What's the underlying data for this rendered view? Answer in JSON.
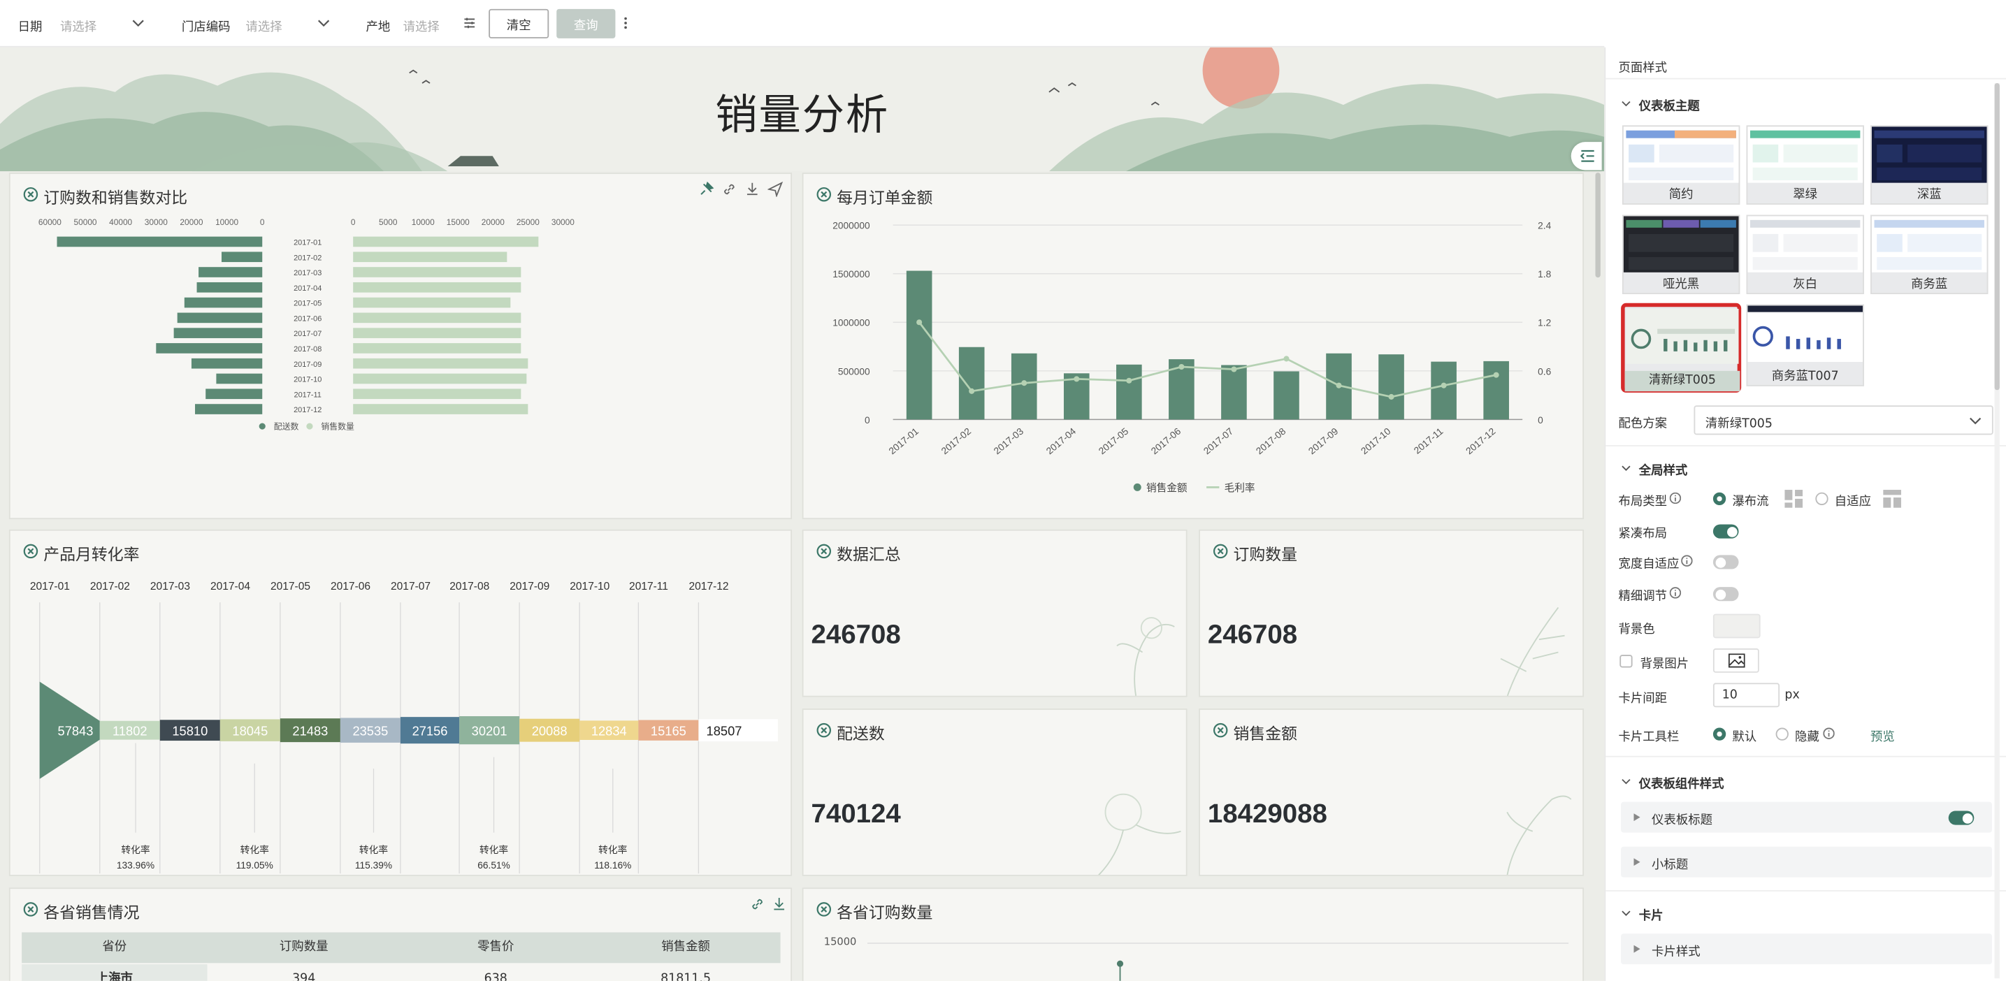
{
  "filters": {
    "date_label": "日期",
    "date_placeholder": "请选择",
    "store_label": "门店编码",
    "store_placeholder": "请选择",
    "origin_label": "产地",
    "origin_placeholder": "请选择",
    "clear_label": "清空",
    "query_label": "查询"
  },
  "dashboard": {
    "title": "销量分析"
  },
  "cards": {
    "purchase_vs_sales": {
      "title": "订购数和销售数对比"
    },
    "monthly_amount": {
      "title": "每月订单金额"
    },
    "conversion": {
      "title": "产品月转化率"
    },
    "summary": {
      "title": "数据汇总",
      "value": "246708"
    },
    "order_qty": {
      "title": "订购数量",
      "value": "246708"
    },
    "delivery": {
      "title": "配送数",
      "value": "740124"
    },
    "sales_amount": {
      "title": "销售金额",
      "value": "18429088"
    },
    "province_sales": {
      "title": "各省销售情况",
      "columns": [
        "省份",
        "订购数量",
        "零售价",
        "销售金额"
      ],
      "rows": [
        [
          "上海市",
          "394",
          "638",
          "81811.5"
        ]
      ]
    },
    "province_orders": {
      "title": "各省订购数量"
    }
  },
  "chart_data": [
    {
      "type": "bar",
      "title": "订购数和销售数对比",
      "categories": [
        "2017-01",
        "2017-02",
        "2017-03",
        "2017-04",
        "2017-05",
        "2017-06",
        "2017-07",
        "2017-08",
        "2017-09",
        "2017-10",
        "2017-11",
        "2017-12"
      ],
      "left_axis_ticks": [
        "60000",
        "50000",
        "40000",
        "30000",
        "20000",
        "10000",
        "0"
      ],
      "right_axis_ticks": [
        "0",
        "5000",
        "10000",
        "15000",
        "20000",
        "25000",
        "30000"
      ],
      "series": [
        {
          "name": "配送数",
          "values": [
            58000,
            11500,
            18000,
            18500,
            22000,
            24000,
            25000,
            30000,
            20000,
            13000,
            16000,
            19000
          ]
        },
        {
          "name": "销售数量",
          "values": [
            26500,
            22000,
            24000,
            24000,
            22500,
            24000,
            24000,
            24000,
            25000,
            24800,
            24000,
            25000
          ]
        }
      ]
    },
    {
      "type": "bar",
      "title": "每月订单金额",
      "categories": [
        "2017-01",
        "2017-02",
        "2017-03",
        "2017-04",
        "2017-05",
        "2017-06",
        "2017-07",
        "2017-08",
        "2017-09",
        "2017-10",
        "2017-11",
        "2017-12"
      ],
      "y_ticks": [
        "0",
        "500000",
        "1000000",
        "1500000",
        "2000000"
      ],
      "y2_ticks": [
        "0",
        "0.6",
        "1.2",
        "1.8",
        "2.4"
      ],
      "ylim": [
        0,
        2000000
      ],
      "y2lim": [
        0,
        2.4
      ],
      "series": [
        {
          "name": "销售金额",
          "type": "bar",
          "values": [
            1530000,
            745000,
            680000,
            475000,
            565000,
            620000,
            560000,
            495000,
            680000,
            670000,
            595000,
            600000
          ]
        },
        {
          "name": "毛利率",
          "type": "line",
          "axis": "right",
          "values": [
            1.2,
            0.35,
            0.45,
            0.5,
            0.48,
            0.65,
            0.62,
            0.75,
            0.42,
            0.28,
            0.42,
            0.55
          ]
        }
      ]
    },
    {
      "type": "funnel",
      "title": "产品月转化率",
      "categories": [
        "2017-01",
        "2017-02",
        "2017-03",
        "2017-04",
        "2017-05",
        "2017-06",
        "2017-07",
        "2017-08",
        "2017-09",
        "2017-10",
        "2017-11",
        "2017-12"
      ],
      "values": [
        57843,
        11802,
        15810,
        18045,
        21483,
        23535,
        27156,
        30201,
        20088,
        12834,
        15165,
        18507
      ],
      "rate_label": "转化率",
      "rates": [
        "133.96%",
        "119.05%",
        "115.39%",
        "66.51%",
        "118.16%"
      ]
    },
    {
      "type": "line",
      "title": "各省订购数量",
      "y_ticks": [
        "15000"
      ]
    }
  ],
  "panel": {
    "title": "页面样式",
    "theme_section": "仪表板主题",
    "themes": [
      "简约",
      "翠绿",
      "深蓝",
      "哑光黑",
      "灰白",
      "商务蓝",
      "清新绿T005",
      "商务蓝T007"
    ],
    "scheme_label": "配色方案",
    "scheme_value": "清新绿T005",
    "global_section": "全局样式",
    "layout_type_label": "布局类型",
    "layout_waterfall": "瀑布流",
    "layout_adaptive": "自适应",
    "compact_label": "紧凑布局",
    "width_adapt_label": "宽度自适应",
    "fine_tune_label": "精细调节",
    "bg_color_label": "背景色",
    "bg_image_label": "背景图片",
    "gap_label": "卡片间距",
    "gap_value": "10",
    "gap_unit": "px",
    "toolbar_label": "卡片工具栏",
    "toolbar_default": "默认",
    "toolbar_hidden": "隐藏",
    "preview_label": "预览",
    "component_section": "仪表板组件样式",
    "dashboard_title_item": "仪表板标题",
    "subtitle_item": "小标题",
    "card_section": "卡片",
    "card_style_item": "卡片样式"
  }
}
